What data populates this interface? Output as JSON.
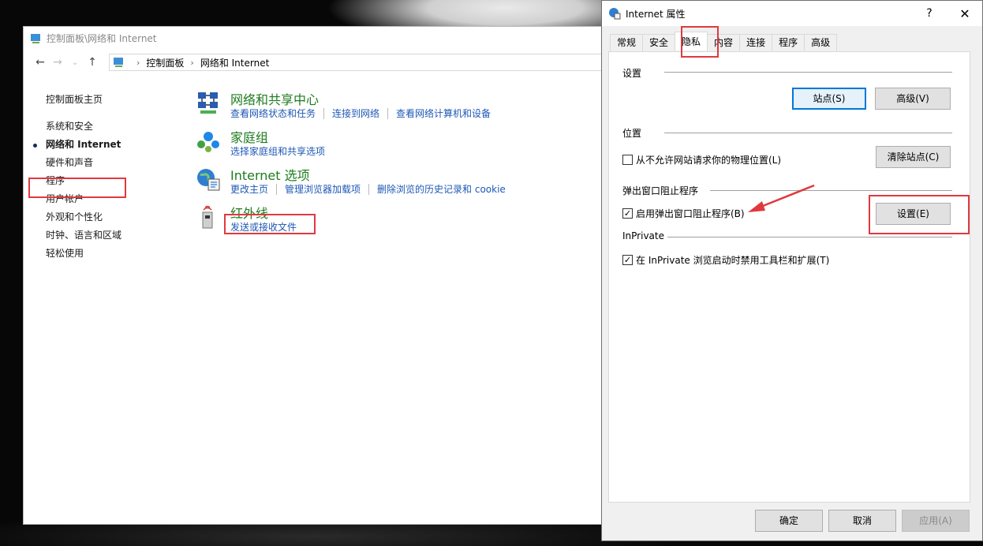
{
  "control_panel": {
    "title": "控制面板\\网络和 Internet",
    "address": {
      "segments": [
        "控制面板",
        "网络和 Internet"
      ]
    },
    "sidebar": {
      "home": "控制面板主页",
      "items": [
        {
          "label": "系统和安全"
        },
        {
          "label": "网络和 Internet"
        },
        {
          "label": "硬件和声音"
        },
        {
          "label": "程序"
        },
        {
          "label": "用户帐户"
        },
        {
          "label": "外观和个性化"
        },
        {
          "label": "时钟、语言和区域"
        },
        {
          "label": "轻松使用"
        }
      ]
    },
    "categories": [
      {
        "title": "网络和共享中心",
        "links": [
          "查看网络状态和任务",
          "连接到网络",
          "查看网络计算机和设备"
        ]
      },
      {
        "title": "家庭组",
        "links": [
          "选择家庭组和共享选项"
        ]
      },
      {
        "title": "Internet 选项",
        "links": [
          "更改主页",
          "管理浏览器加载项",
          "删除浏览的历史记录和 cookie"
        ]
      },
      {
        "title": "红外线",
        "links": [
          "发送或接收文件"
        ]
      }
    ]
  },
  "dialog": {
    "title": "Internet 属性",
    "help": "?",
    "close": "✕",
    "tabs": [
      "常规",
      "安全",
      "隐私",
      "内容",
      "连接",
      "程序",
      "高级"
    ],
    "groups": {
      "settings": "设置",
      "location": "位置",
      "popup": "弹出窗口阻止程序",
      "inprivate": "InPrivate"
    },
    "buttons": {
      "sites": "站点(S)",
      "advanced": "高级(V)",
      "clear_sites": "清除站点(C)",
      "popup_settings": "设置(E)",
      "ok": "确定",
      "cancel": "取消",
      "apply": "应用(A)"
    },
    "checkboxes": {
      "location": {
        "label": "从不允许网站请求你的物理位置(L)",
        "checked": false
      },
      "popup": {
        "label": "启用弹出窗口阻止程序(B)",
        "checked": true
      },
      "inprivate": {
        "label": "在 InPrivate 浏览启动时禁用工具栏和扩展(T)",
        "checked": true
      }
    }
  },
  "colors": {
    "highlight": "#e0393e",
    "link": "#1e58b5",
    "category": "#1e7b1e"
  }
}
